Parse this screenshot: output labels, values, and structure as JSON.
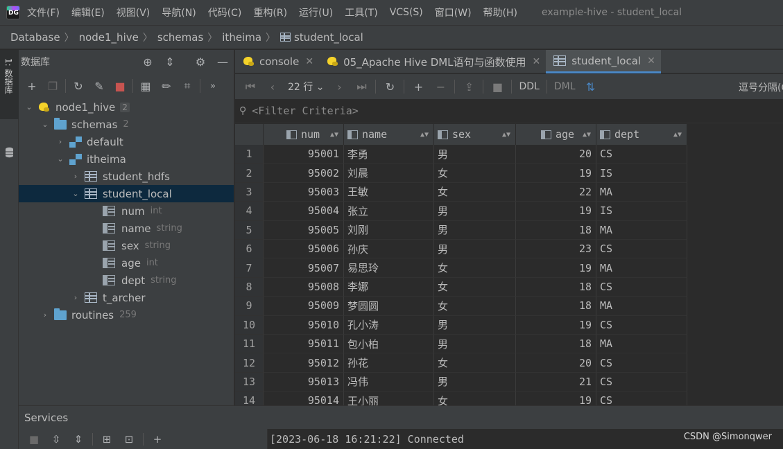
{
  "app": {
    "logo_text": "DG",
    "window_title": "example-hive - student_local"
  },
  "menu": [
    "文件(F)",
    "编辑(E)",
    "视图(V)",
    "导航(N)",
    "代码(C)",
    "重构(R)",
    "运行(U)",
    "工具(T)",
    "VCS(S)",
    "窗口(W)",
    "帮助(H)"
  ],
  "breadcrumb": [
    "Database",
    "node1_hive",
    "schemas",
    "itheima",
    "student_local"
  ],
  "left_strip": {
    "tab_label": "1: 数据库"
  },
  "db_panel": {
    "title": "数据库",
    "tree": [
      {
        "label": "node1_hive",
        "badge": "2"
      },
      {
        "label": "schemas",
        "extra": "2"
      },
      {
        "label": "default"
      },
      {
        "label": "itheima"
      },
      {
        "label": "student_hdfs"
      },
      {
        "label": "student_local"
      },
      {
        "label": "num",
        "extra": "int"
      },
      {
        "label": "name",
        "extra": "string"
      },
      {
        "label": "sex",
        "extra": "string"
      },
      {
        "label": "age",
        "extra": "int"
      },
      {
        "label": "dept",
        "extra": "string"
      },
      {
        "label": "t_archer"
      },
      {
        "label": "routines",
        "extra": "259"
      }
    ]
  },
  "tabs": [
    {
      "label": "console"
    },
    {
      "label": "05_Apache Hive DML语句与函数使用"
    },
    {
      "label": "student_local",
      "active": true
    }
  ],
  "editor_toolbar": {
    "row_count": "22 行",
    "ddl": "DDL",
    "dml": "DML",
    "separator_option": "逗号分隔(C"
  },
  "filter": {
    "placeholder": "<Filter Criteria>"
  },
  "grid": {
    "columns": [
      "num",
      "name",
      "sex",
      "age",
      "dept"
    ],
    "rows": [
      [
        "1",
        "95001",
        "李勇",
        "男",
        "20",
        "CS"
      ],
      [
        "2",
        "95002",
        "刘晨",
        "女",
        "19",
        "IS"
      ],
      [
        "3",
        "95003",
        "王敏",
        "女",
        "22",
        "MA"
      ],
      [
        "4",
        "95004",
        "张立",
        "男",
        "19",
        "IS"
      ],
      [
        "5",
        "95005",
        "刘刚",
        "男",
        "18",
        "MA"
      ],
      [
        "6",
        "95006",
        "孙庆",
        "男",
        "23",
        "CS"
      ],
      [
        "7",
        "95007",
        "易思玲",
        "女",
        "19",
        "MA"
      ],
      [
        "8",
        "95008",
        "李娜",
        "女",
        "18",
        "CS"
      ],
      [
        "9",
        "95009",
        "梦圆圆",
        "女",
        "18",
        "MA"
      ],
      [
        "10",
        "95010",
        "孔小涛",
        "男",
        "19",
        "CS"
      ],
      [
        "11",
        "95011",
        "包小柏",
        "男",
        "18",
        "MA"
      ],
      [
        "12",
        "95012",
        "孙花",
        "女",
        "20",
        "CS"
      ],
      [
        "13",
        "95013",
        "冯伟",
        "男",
        "21",
        "CS"
      ],
      [
        "14",
        "95014",
        "王小丽",
        "女",
        "19",
        "CS"
      ]
    ]
  },
  "services": {
    "title": "Services",
    "console_output": "[2023-06-18 16:21:22] Connected"
  },
  "watermark": "CSDN @Simonqwer"
}
